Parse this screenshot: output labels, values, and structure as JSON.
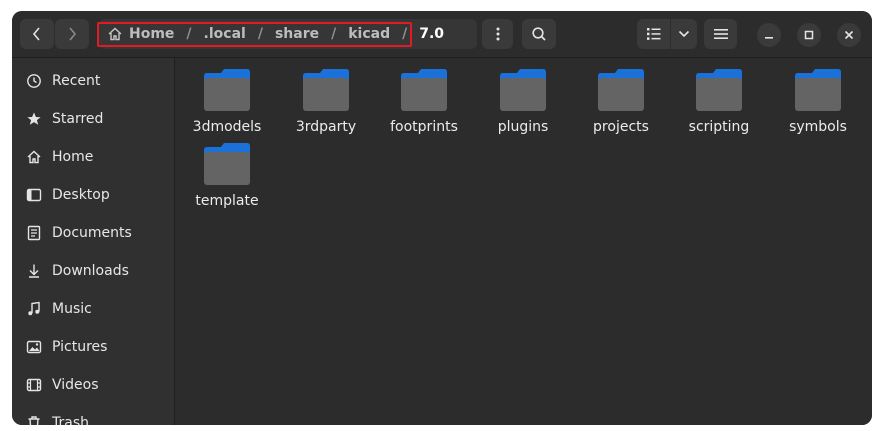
{
  "breadcrumb": {
    "segments": [
      {
        "label": "Home",
        "icon": "home-icon"
      },
      {
        "label": ".local"
      },
      {
        "label": "share"
      },
      {
        "label": "kicad"
      },
      {
        "label": "7.0",
        "current": true
      }
    ],
    "separator": "/"
  },
  "sidebar": {
    "items": [
      {
        "label": "Recent",
        "icon": "clock-icon"
      },
      {
        "label": "Starred",
        "icon": "star-icon"
      },
      {
        "label": "Home",
        "icon": "home-icon"
      },
      {
        "label": "Desktop",
        "icon": "desktop-icon"
      },
      {
        "label": "Documents",
        "icon": "document-icon"
      },
      {
        "label": "Downloads",
        "icon": "download-icon"
      },
      {
        "label": "Music",
        "icon": "music-icon"
      },
      {
        "label": "Pictures",
        "icon": "picture-icon"
      },
      {
        "label": "Videos",
        "icon": "video-icon"
      },
      {
        "label": "Trash",
        "icon": "trash-icon"
      }
    ]
  },
  "folders": [
    {
      "name": "3dmodels"
    },
    {
      "name": "3rdparty"
    },
    {
      "name": "footprints"
    },
    {
      "name": "plugins"
    },
    {
      "name": "projects"
    },
    {
      "name": "scripting"
    },
    {
      "name": "symbols"
    },
    {
      "name": "template"
    }
  ],
  "colors": {
    "highlight": "#e01b24",
    "folder_tab": "#1c71d8",
    "folder_body": "#646464"
  }
}
